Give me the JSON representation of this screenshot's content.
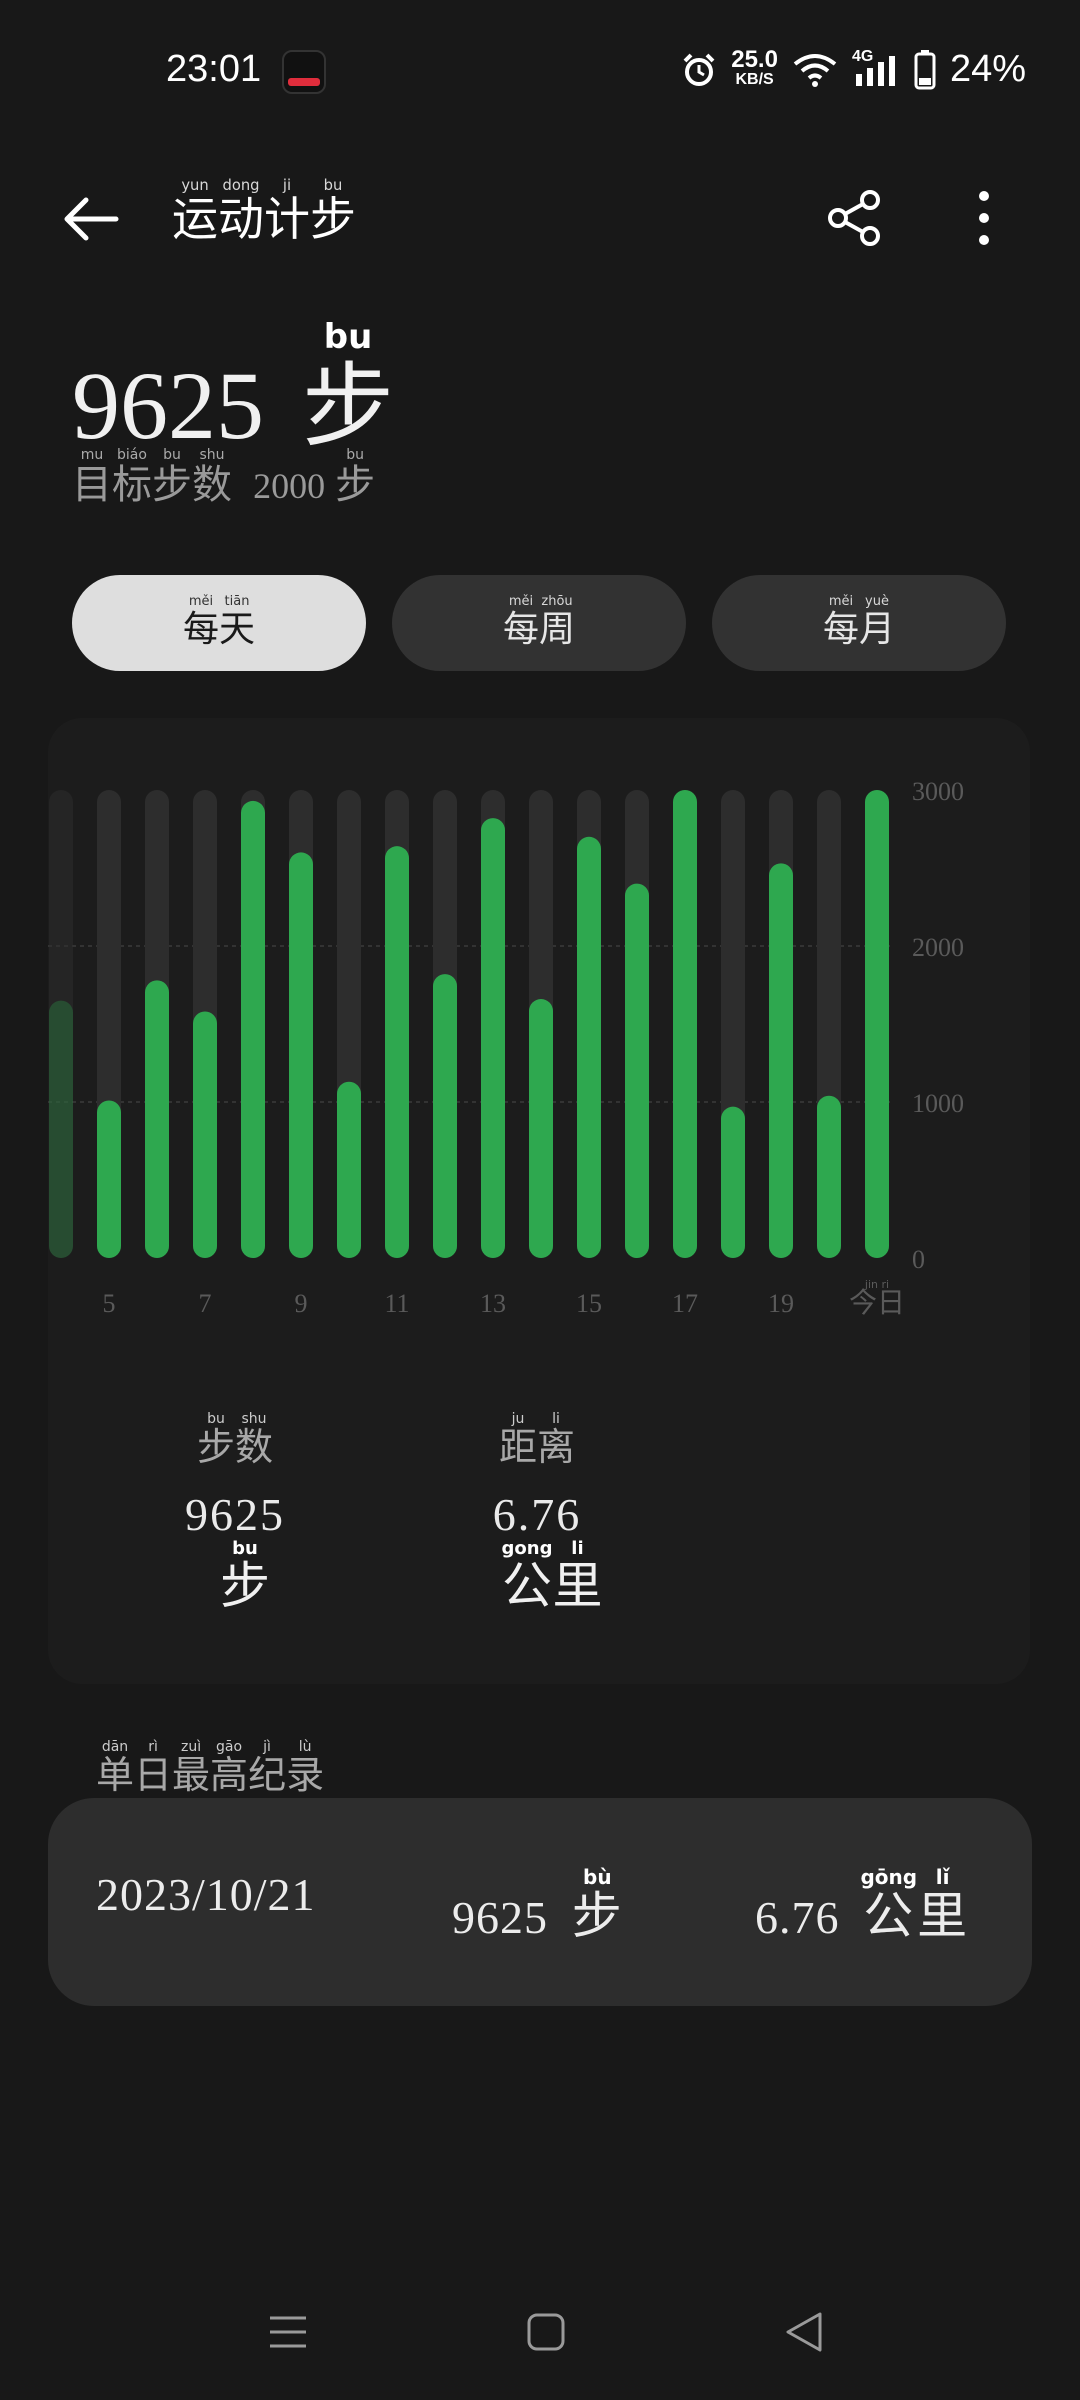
{
  "status_bar": {
    "time": "23:01",
    "net_speed_value": "25.0",
    "net_speed_unit": "KB/S",
    "network_type": "4G",
    "battery": "24%"
  },
  "header": {
    "title_chars": [
      "运",
      "动",
      "计",
      "步"
    ],
    "title_pinyin": [
      "yun",
      "dong",
      "ji",
      "bu"
    ]
  },
  "summary": {
    "steps": "9625",
    "steps_unit": "步",
    "steps_unit_pinyin": "bu",
    "goal_label_chars": [
      "目",
      "标",
      "步",
      "数"
    ],
    "goal_label_pinyin": [
      "mu",
      "biáo",
      "bu",
      "shu"
    ],
    "goal_value": "2000",
    "goal_unit": "步",
    "goal_unit_pinyin": "bu"
  },
  "tabs": [
    {
      "chars": [
        "每",
        "天"
      ],
      "pinyin": [
        "měi",
        "tiān"
      ],
      "active": true
    },
    {
      "chars": [
        "每",
        "周"
      ],
      "pinyin": [
        "měi",
        "zhōu"
      ],
      "active": false
    },
    {
      "chars": [
        "每",
        "月"
      ],
      "pinyin": [
        "měi",
        "yuè"
      ],
      "active": false
    }
  ],
  "chart_data": {
    "type": "bar",
    "categories": [
      "4",
      "5",
      "6",
      "7",
      "8",
      "9",
      "10",
      "11",
      "12",
      "13",
      "14",
      "15",
      "16",
      "17",
      "18",
      "19",
      "20",
      "今日"
    ],
    "values": [
      1650,
      1010,
      1780,
      1580,
      2930,
      2600,
      1130,
      2640,
      1820,
      2820,
      1660,
      2700,
      2400,
      3000,
      970,
      2530,
      1040,
      3000
    ],
    "x_tick_labels": [
      "5",
      "7",
      "9",
      "11",
      "13",
      "15",
      "17",
      "19"
    ],
    "today_label_chars": [
      "今",
      "日"
    ],
    "today_label_pinyin": [
      "jin",
      "ri"
    ],
    "y_ticks": [
      "3000",
      "2000",
      "1000",
      "0"
    ],
    "ylim": [
      0,
      3000
    ],
    "grid": true,
    "bar_color": "#2ea84f",
    "track_color": "#2d2d2d"
  },
  "stats": {
    "steps_label_chars": [
      "步",
      "数"
    ],
    "steps_label_pinyin": [
      "bu",
      "shu"
    ],
    "steps_value": "9625",
    "steps_unit": "步",
    "steps_unit_pinyin": "bu",
    "distance_label_chars": [
      "距",
      "离"
    ],
    "distance_label_pinyin": [
      "ju",
      "li"
    ],
    "distance_value": "6.76",
    "distance_unit_chars": [
      "公",
      "里"
    ],
    "distance_unit_pinyin": [
      "gong",
      "li"
    ]
  },
  "record": {
    "title_chars": [
      "单",
      "日",
      "最",
      "高",
      "纪",
      "录"
    ],
    "title_pinyin": [
      "dān",
      "rì",
      "zuì",
      "gāo",
      "jì",
      "lù"
    ],
    "date": "2023/10/21",
    "steps": "9625",
    "steps_unit": "步",
    "steps_unit_pinyin": "bù",
    "distance": "6.76",
    "distance_unit_chars": [
      "公",
      "里"
    ],
    "distance_unit_pinyin": [
      "gōng",
      "lǐ"
    ]
  },
  "icons": {
    "back": "arrow-left-icon",
    "share": "share-icon",
    "more": "more-vertical-icon",
    "alarm": "alarm-icon",
    "wifi": "wifi-icon",
    "signal": "signal-icon",
    "battery": "battery-icon",
    "nav_menu": "menu-icon",
    "nav_home": "home-square-icon",
    "nav_back": "triangle-back-icon"
  }
}
